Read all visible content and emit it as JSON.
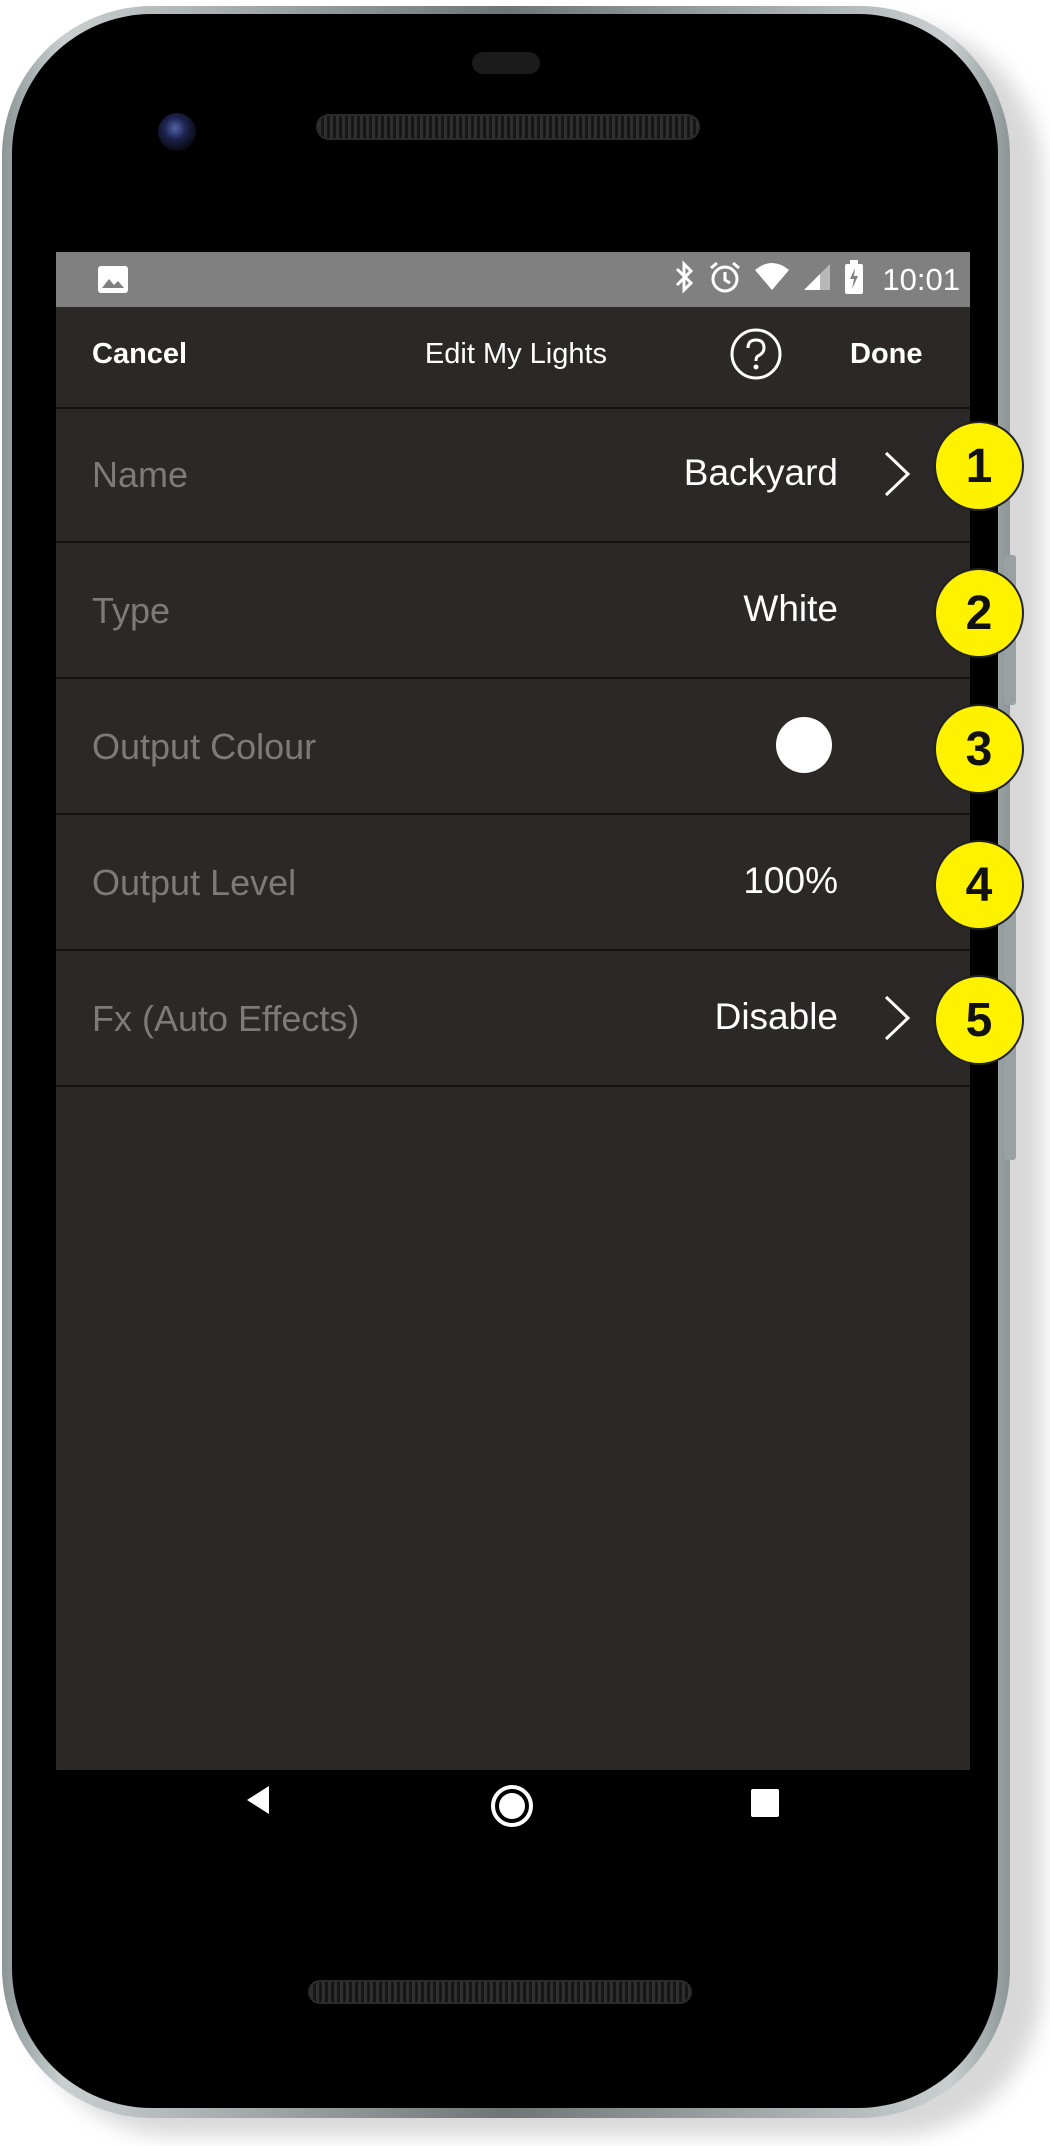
{
  "status_bar": {
    "time": "10:01",
    "icons": [
      "image-icon",
      "bluetooth-icon",
      "alarm-icon",
      "wifi-icon",
      "signal-icon",
      "battery-charging-icon"
    ]
  },
  "app_bar": {
    "cancel_label": "Cancel",
    "title": "Edit My Lights",
    "help_icon": "help-circle-icon",
    "done_label": "Done"
  },
  "settings": {
    "rows": [
      {
        "label": "Name",
        "value": "Backyard",
        "has_chevron": true
      },
      {
        "label": "Type",
        "value": "White",
        "has_chevron": false
      },
      {
        "label": "Output Colour",
        "value": "",
        "color": "#ffffff",
        "has_chevron": false
      },
      {
        "label": "Output Level",
        "value": "100%",
        "has_chevron": false
      },
      {
        "label": "Fx (Auto Effects)",
        "value": "Disable",
        "has_chevron": true
      }
    ]
  },
  "nav_bar": {
    "icons": [
      "back-icon",
      "home-icon",
      "recent-apps-icon"
    ]
  },
  "callouts": [
    "1",
    "2",
    "3",
    "4",
    "5"
  ],
  "colors": {
    "screen_background": "#2d2828",
    "status_bar": "#808080",
    "label_text": "#7e7a7a",
    "value_text": "#ffffff",
    "callout_fill": "#fff200"
  }
}
